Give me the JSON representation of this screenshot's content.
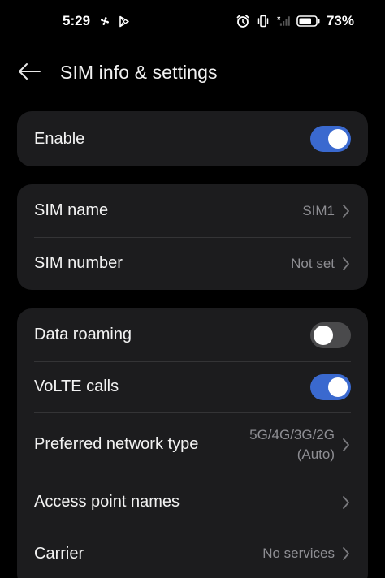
{
  "status_bar": {
    "time": "5:29",
    "battery": "73%",
    "icons_left": [
      "fan-icon",
      "play-store-icon"
    ],
    "icons_right": [
      "alarm-icon",
      "vibrate-icon",
      "no-signal-icon",
      "battery-icon"
    ]
  },
  "header": {
    "title": "SIM info & settings",
    "back_icon": "arrow-left-icon"
  },
  "colors": {
    "background": "#000000",
    "card": "#1c1c1e",
    "toggle_on": "#3a69cf",
    "toggle_off": "#4a4a4c",
    "secondary_text": "#8e8e93"
  },
  "card1": {
    "enable": {
      "label": "Enable",
      "toggle": "on"
    }
  },
  "card2": {
    "sim_name": {
      "label": "SIM name",
      "value": "SIM1"
    },
    "sim_number": {
      "label": "SIM number",
      "value": "Not set"
    }
  },
  "card3": {
    "data_roaming": {
      "label": "Data roaming",
      "toggle": "off"
    },
    "volte": {
      "label": "VoLTE calls",
      "toggle": "on"
    },
    "network_type": {
      "label": "Preferred network type",
      "value_line1": "5G/4G/3G/2G",
      "value_line2": "(Auto)"
    },
    "apn": {
      "label": "Access point names"
    },
    "carrier": {
      "label": "Carrier",
      "value": "No services"
    }
  }
}
